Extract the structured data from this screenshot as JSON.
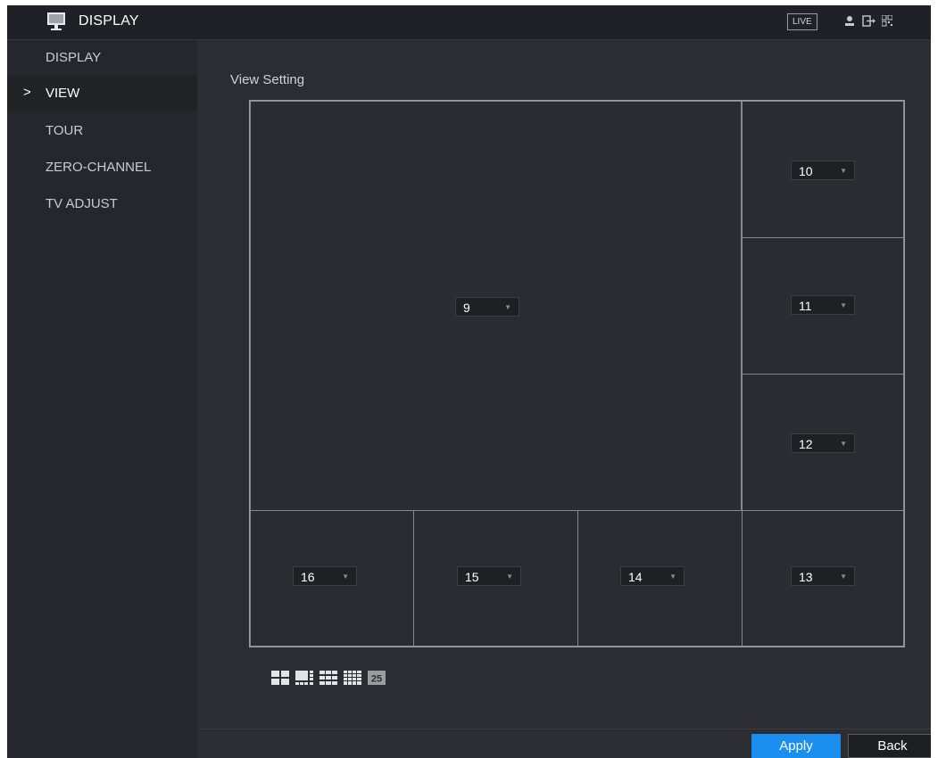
{
  "header": {
    "title": "DISPLAY",
    "live_label": "LIVE",
    "icons": [
      "monitor-icon",
      "user-icon",
      "logout-icon",
      "qr-code-icon"
    ]
  },
  "sidebar": {
    "items": [
      {
        "label": "DISPLAY",
        "active": false
      },
      {
        "label": "VIEW",
        "active": true
      },
      {
        "label": "TOUR",
        "active": false
      },
      {
        "label": "ZERO-CHANNEL",
        "active": false
      },
      {
        "label": "TV ADJUST",
        "active": false
      }
    ],
    "active_marker": ">"
  },
  "main": {
    "section_title": "View Setting",
    "cells": [
      {
        "value": "9"
      },
      {
        "value": "10"
      },
      {
        "value": "11"
      },
      {
        "value": "12"
      },
      {
        "value": "13"
      },
      {
        "value": "14"
      },
      {
        "value": "15"
      },
      {
        "value": "16"
      }
    ],
    "dropdown_arrow": "▼",
    "layout_options": [
      {
        "icon": "split-4-icon"
      },
      {
        "icon": "split-8-icon"
      },
      {
        "icon": "split-9-icon"
      },
      {
        "icon": "split-16-icon"
      },
      {
        "icon": "split-25-icon",
        "label": "25"
      }
    ]
  },
  "footer": {
    "apply_label": "Apply",
    "back_label": "Back"
  },
  "colors": {
    "accent": "#1a8ff0",
    "background": "#2b2d33",
    "sidebar": "#25272c"
  }
}
